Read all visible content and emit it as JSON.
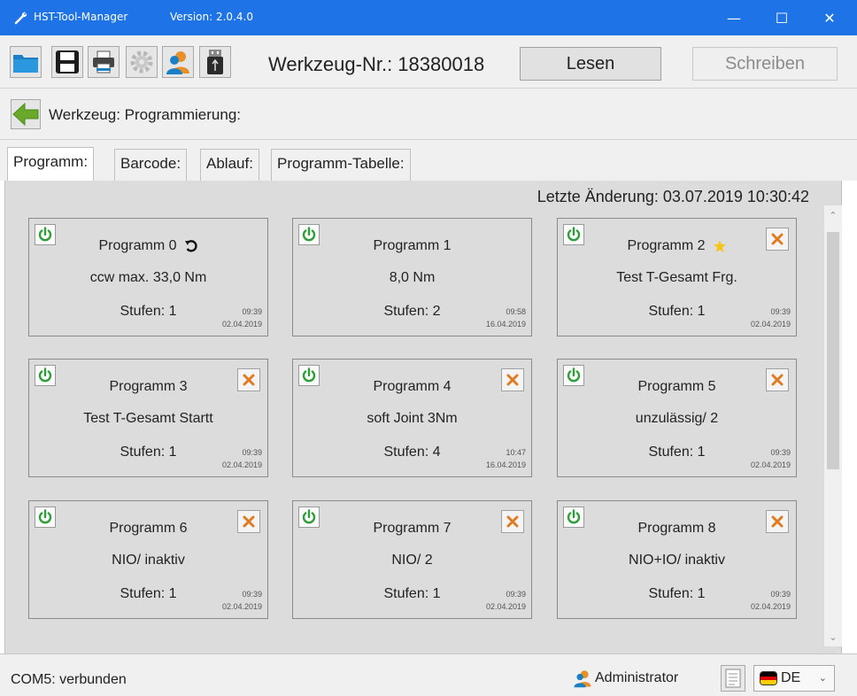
{
  "window": {
    "title": "HST-Tool-Manager",
    "version": "Version: 2.0.4.0",
    "minimize": "—",
    "maximize": "☐",
    "close": "✕"
  },
  "toolbar": {
    "icons": [
      "folder-icon",
      "save-icon",
      "printer-icon",
      "gear-icon",
      "user-icon",
      "usb-icon"
    ],
    "tool_number": "Werkzeug-Nr.: 18380018",
    "read_label": "Lesen",
    "write_label": "Schreiben"
  },
  "breadcrumb": {
    "text": "Werkzeug: Programmierung:"
  },
  "tabs": [
    {
      "label": "Programm:",
      "active": true
    },
    {
      "label": "Barcode:",
      "active": false
    },
    {
      "label": "Ablauf:",
      "active": false
    },
    {
      "label": "Programm-Tabelle:",
      "active": false
    }
  ],
  "last_change": "Letzte Änderung:  03.07.2019  10:30:42",
  "programs": [
    {
      "title": "Programm 0",
      "desc": "ccw max. 33,0 Nm",
      "steps": "Stufen: 1",
      "time": "09:39",
      "date": "02.04.2019"
    },
    {
      "title": "Programm 1",
      "desc": "8,0 Nm",
      "steps": "Stufen: 2",
      "time": "09:58",
      "date": "16.04.2019"
    },
    {
      "title": "Programm 2",
      "desc": "Test T-Gesamt Frg.",
      "steps": "Stufen: 1",
      "time": "09:39",
      "date": "02.04.2019"
    },
    {
      "title": "Programm 3",
      "desc": "Test T-Gesamt Startt",
      "steps": "Stufen: 1",
      "time": "09:39",
      "date": "02.04.2019"
    },
    {
      "title": "Programm 4",
      "desc": "soft Joint 3Nm",
      "steps": "Stufen: 4",
      "time": "10:47",
      "date": "16.04.2019"
    },
    {
      "title": "Programm 5",
      "desc": "unzulässig/ 2",
      "steps": "Stufen: 1",
      "time": "09:39",
      "date": "02.04.2019"
    },
    {
      "title": "Programm 6",
      "desc": "NIO/ inaktiv",
      "steps": "Stufen: 1",
      "time": "09:39",
      "date": "02.04.2019"
    },
    {
      "title": "Programm 7",
      "desc": "NIO/ 2",
      "steps": "Stufen: 1",
      "time": "09:39",
      "date": "02.04.2019"
    },
    {
      "title": "Programm 8",
      "desc": "NIO+IO/ inaktiv",
      "steps": "Stufen: 1",
      "time": "09:39",
      "date": "02.04.2019"
    }
  ],
  "status": {
    "connection": "COM5: verbunden",
    "user": "Administrator",
    "language": "DE"
  },
  "colors": {
    "titlebar": "#1e73e6",
    "power_green": "#2e9e3a",
    "delete_orange": "#e07b20",
    "star_yellow": "#f5c518"
  }
}
